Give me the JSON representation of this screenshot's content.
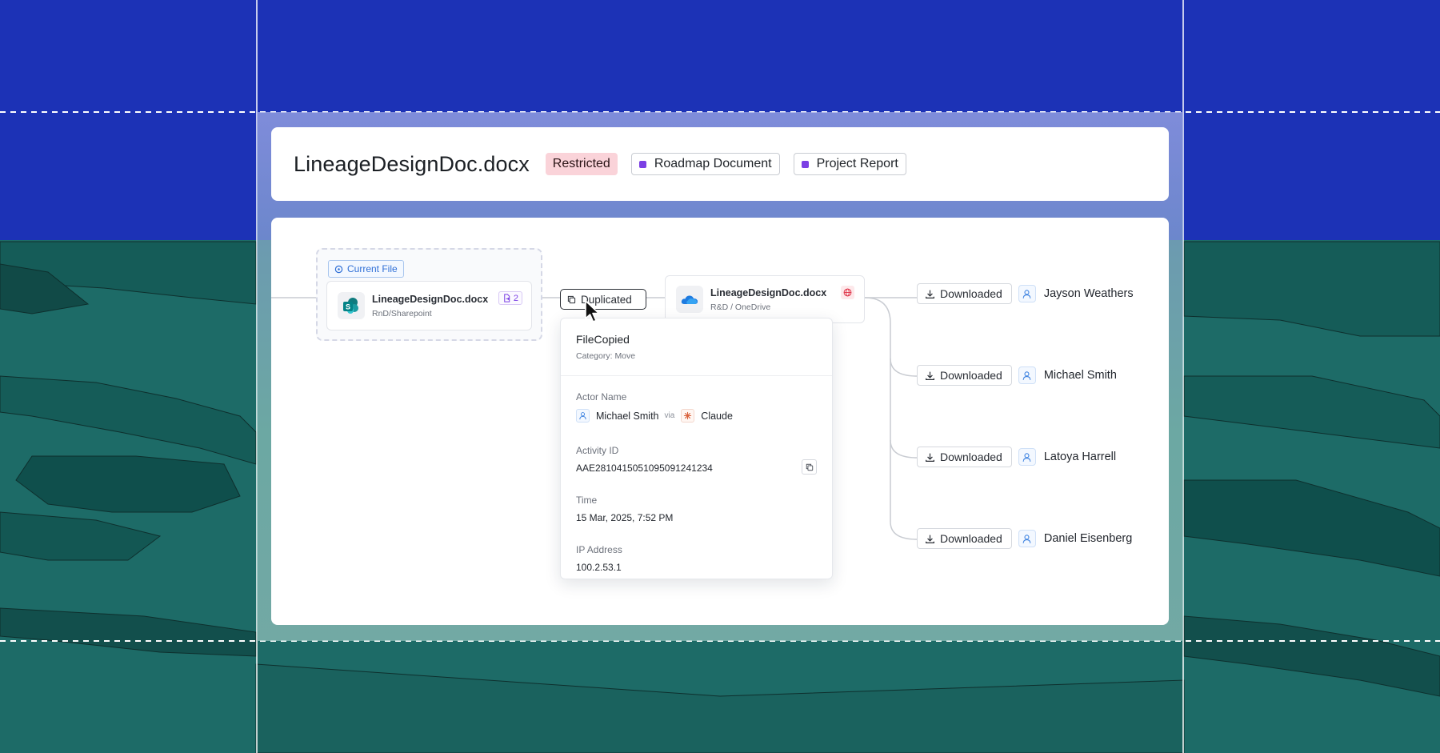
{
  "header": {
    "file_title": "LineageDesignDoc.docx",
    "tags": [
      {
        "label": "Restricted",
        "kind": "restricted"
      },
      {
        "label": "Roadmap Document",
        "kind": "label"
      },
      {
        "label": "Project Report",
        "kind": "label"
      }
    ]
  },
  "lineage": {
    "current_badge": "Current File",
    "source_file": {
      "name": "LineageDesignDoc.docx",
      "location": "RnD/Sharepoint",
      "versions": "2",
      "icon": "sharepoint-icon"
    },
    "action": {
      "label": "Duplicated",
      "icon": "copy-icon"
    },
    "target_file": {
      "name": "LineageDesignDoc.docx",
      "location": "R&D / OneDrive",
      "icon": "onedrive-icon",
      "flag_icon": "globe-icon"
    },
    "downloads": [
      {
        "action": "Downloaded",
        "user": "Jayson Weathers"
      },
      {
        "action": "Downloaded",
        "user": "Michael Smith"
      },
      {
        "action": "Downloaded",
        "user": "Latoya Harrell"
      },
      {
        "action": "Downloaded",
        "user": "Daniel Eisenberg"
      }
    ]
  },
  "popover": {
    "title": "FileCopied",
    "category": "Category: Move",
    "actor_label": "Actor Name",
    "actor_name": "Michael Smith",
    "via": "via",
    "agent": "Claude",
    "activity_label": "Activity ID",
    "activity_id": "AAE281041505109509​1241234",
    "time_label": "Time",
    "time_value": "15 Mar, 2025, 7:52 PM",
    "ip_label": "IP Address",
    "ip_value": "100.2.53.1"
  },
  "colors": {
    "sky": "#1c32b6",
    "ground": "#1b6a66",
    "restricted_bg": "#fad3d9",
    "tag_dot": "#7b3fe4",
    "link_blue": "#2f6fd6"
  }
}
